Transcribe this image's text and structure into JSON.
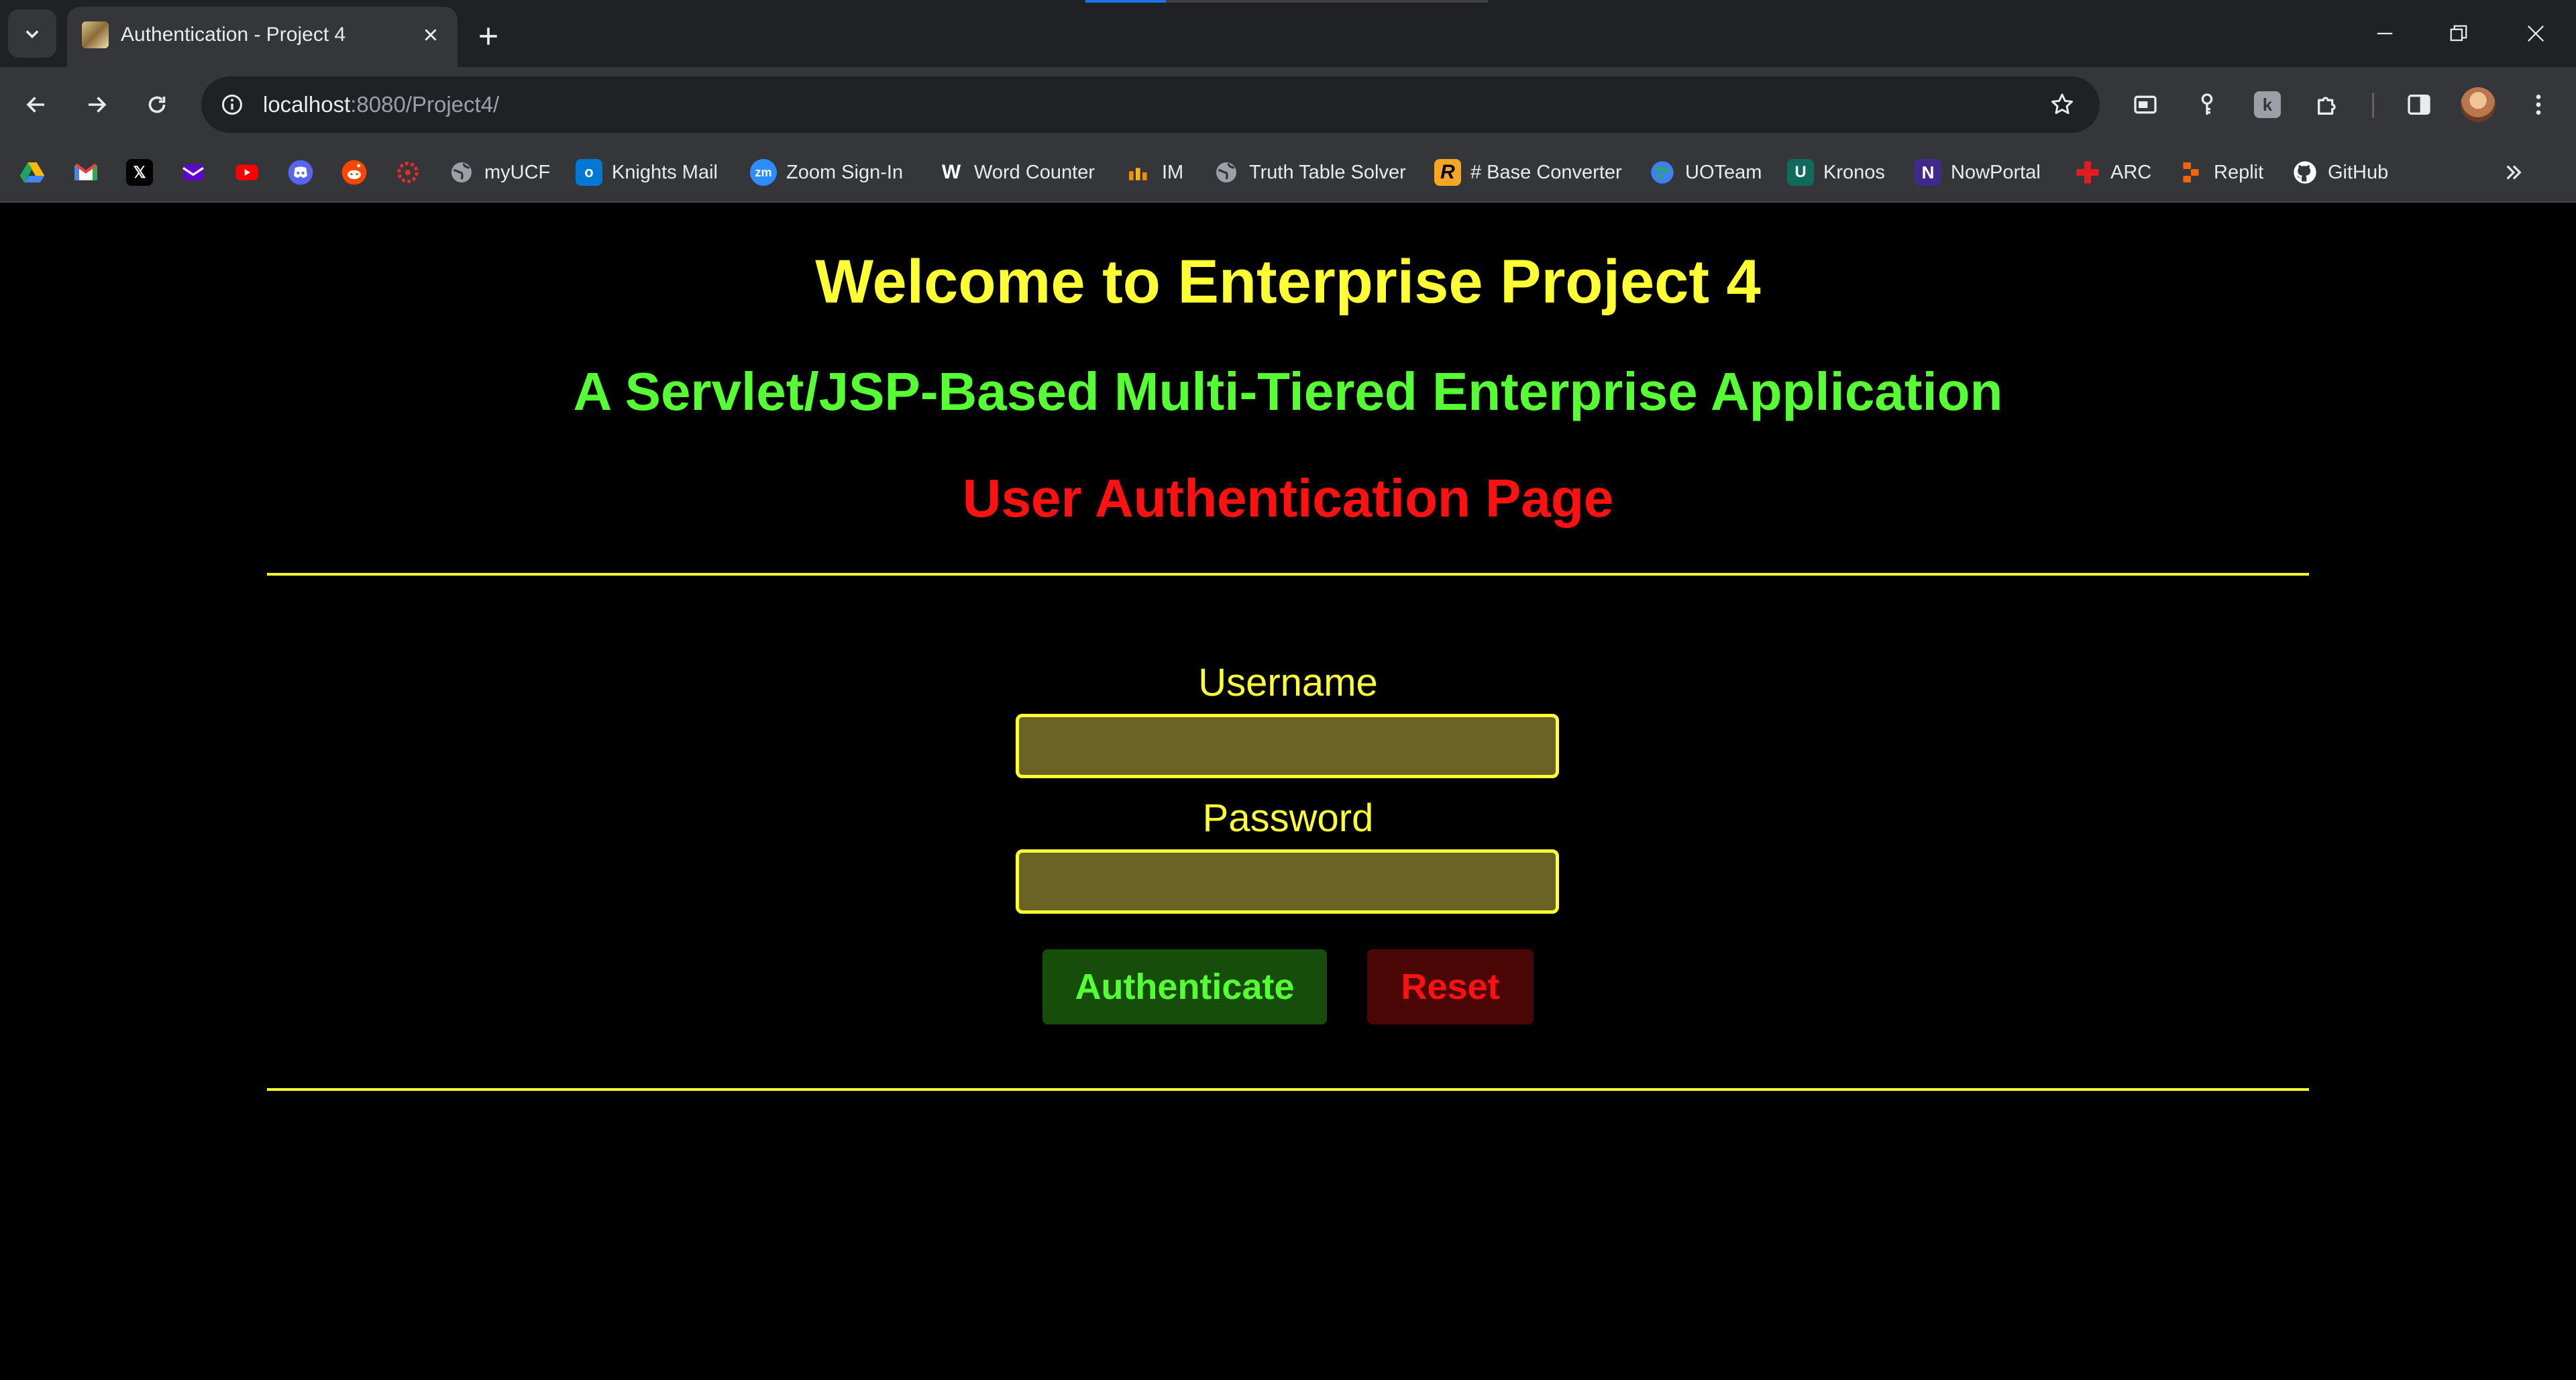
{
  "browser": {
    "tab_title": "Authentication - Project 4",
    "url_host": "localhost",
    "url_rest": ":8080/Project4/",
    "bookmarks": [
      {
        "label": "",
        "icon": "google-drive-icon",
        "color": "#1fa463"
      },
      {
        "label": "",
        "icon": "gmail-icon",
        "color": "#ea4335"
      },
      {
        "label": "",
        "icon": "x-icon",
        "color": "#000000"
      },
      {
        "label": "",
        "icon": "yahoo-mail-icon",
        "color": "#5f01d1"
      },
      {
        "label": "",
        "icon": "youtube-icon",
        "color": "#ff0000"
      },
      {
        "label": "",
        "icon": "discord-icon",
        "color": "#5865f2"
      },
      {
        "label": "",
        "icon": "reddit-icon",
        "color": "#ff4500"
      },
      {
        "label": "",
        "icon": "webcourses-icon",
        "color": "#e22d2d"
      },
      {
        "label": "myUCF",
        "icon": "globe-icon",
        "color": "#9aa0a6"
      },
      {
        "label": "Knights Mail",
        "icon": "outlook-icon",
        "color": "#0078d4"
      },
      {
        "label": "Zoom Sign-In",
        "icon": "zoom-icon",
        "color": "#2d8cff"
      },
      {
        "label": "Word Counter",
        "icon": "word-counter-icon",
        "color": "#35363a"
      },
      {
        "label": "IM",
        "icon": "im-icon",
        "color": "#ff8a00"
      },
      {
        "label": "Truth Table Solver",
        "icon": "globe-icon",
        "color": "#9aa0a6"
      },
      {
        "label": "# Base Converter",
        "icon": "base-converter-icon",
        "color": "#f5a623"
      },
      {
        "label": "UOTeam",
        "icon": "uoteam-icon",
        "color": "#3b82f6"
      },
      {
        "label": "Kronos",
        "icon": "kronos-icon",
        "color": "#0f6b5c"
      },
      {
        "label": "NowPortal",
        "icon": "nowportal-icon",
        "color": "#3f2a8c"
      },
      {
        "label": "ARC",
        "icon": "arc-icon",
        "color": "#e11b22"
      },
      {
        "label": "Replit",
        "icon": "replit-icon",
        "color": "#f26207"
      },
      {
        "label": "GitHub",
        "icon": "github-icon",
        "color": "#ffffff"
      }
    ]
  },
  "page": {
    "title": "Welcome to Enterprise Project 4",
    "subtitle": "A Servlet/JSP-Based Multi-Tiered Enterprise Application",
    "heading": "User Authentication Page",
    "username_label": "Username",
    "username_value": "",
    "password_label": "Password",
    "password_value": "",
    "authenticate_label": "Authenticate",
    "reset_label": "Reset"
  },
  "colors": {
    "background": "#000000",
    "title": "#ffff33",
    "subtitle": "#55ff33",
    "heading": "#ff1111"
  }
}
